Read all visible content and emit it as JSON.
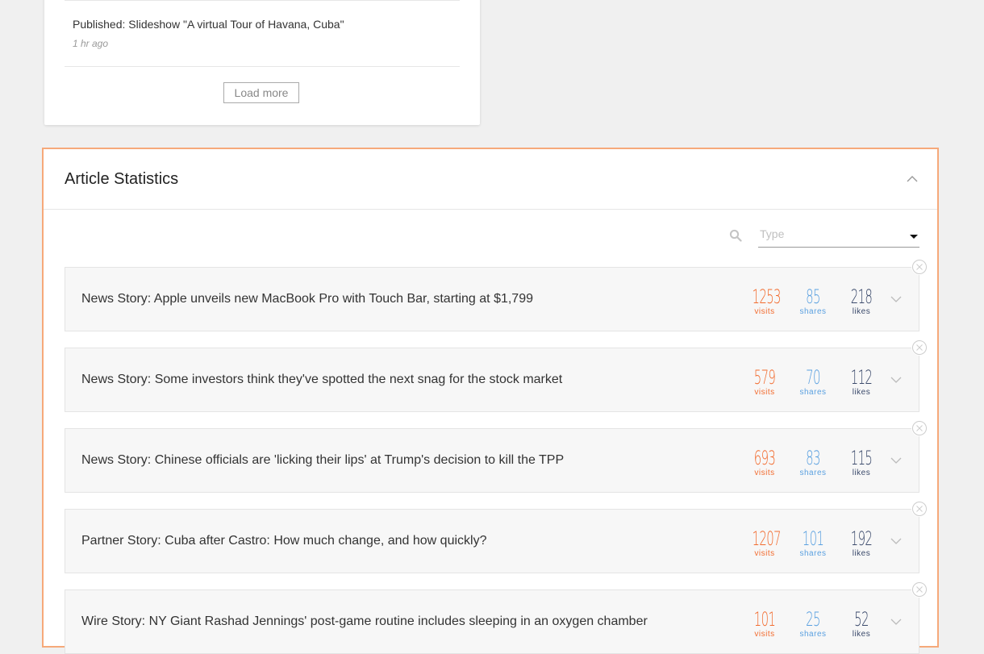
{
  "activity": {
    "item_title": "Published: Slideshow \"A virtual Tour of Havana, Cuba\"",
    "item_time": "1 hr ago",
    "load_more_label": "Load more"
  },
  "stats": {
    "title": "Article Statistics",
    "filter_placeholder": "Type",
    "labels": {
      "visits": "visits",
      "shares": "shares",
      "likes": "likes"
    },
    "colors": {
      "visits": "#f26b2e",
      "shares": "#5aa0e0",
      "likes": "#3b4a6b",
      "panel_border": "#f6a97a"
    },
    "articles": [
      {
        "title": "News Story: Apple unveils new MacBook Pro with Touch Bar, starting at $1,799",
        "visits": "1253",
        "shares": "85",
        "likes": "218"
      },
      {
        "title": "News Story: Some investors think they've spotted the next snag for the stock market",
        "visits": "579",
        "shares": "70",
        "likes": "112"
      },
      {
        "title": "News Story: Chinese officials are 'licking their lips' at Trump's decision to kill the TPP",
        "visits": "693",
        "shares": "83",
        "likes": "115"
      },
      {
        "title": "Partner Story: Cuba after Castro: How much change, and how quickly?",
        "visits": "1207",
        "shares": "101",
        "likes": "192"
      },
      {
        "title": "Wire Story: NY Giant Rashad Jennings' post-game routine includes sleeping in an oxygen chamber",
        "visits": "101",
        "shares": "25",
        "likes": "52"
      }
    ]
  }
}
